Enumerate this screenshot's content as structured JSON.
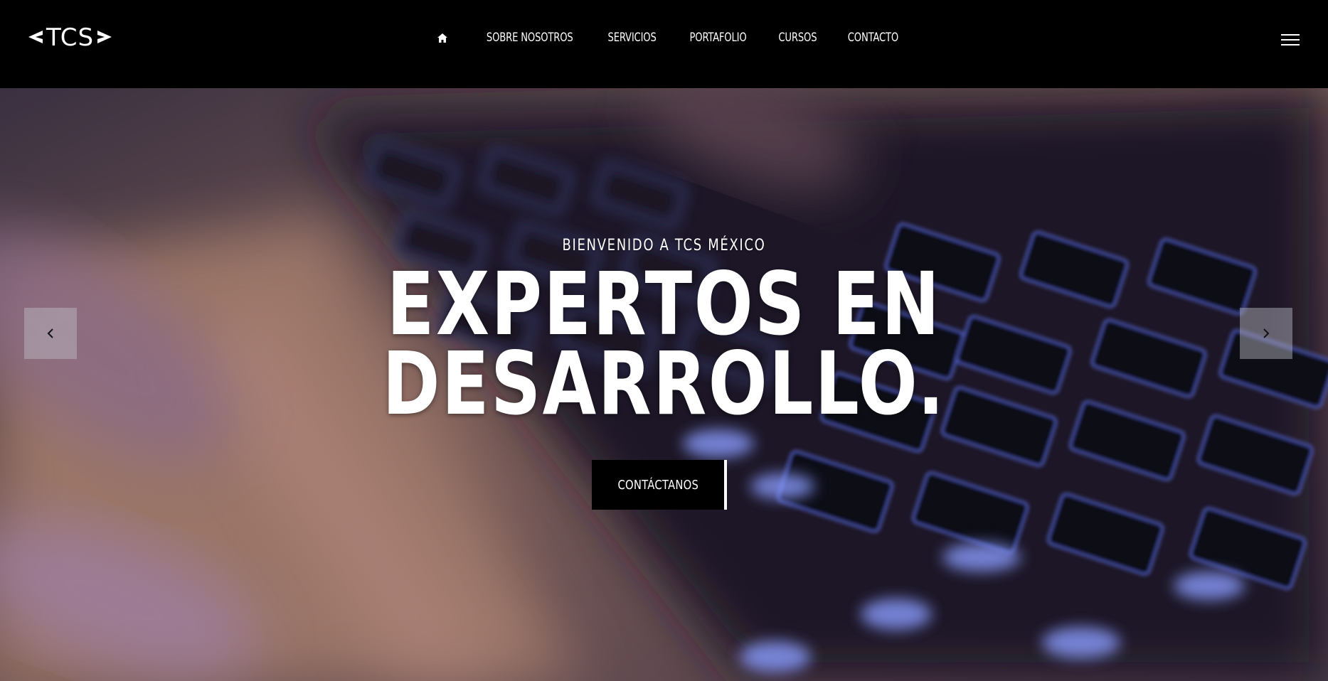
{
  "header": {
    "logo_text": "TCS",
    "nav": [
      {
        "label": "SOBRE NOSOTROS"
      },
      {
        "label": "SERVICIOS"
      },
      {
        "label": "PORTAFOLIO"
      },
      {
        "label": "CURSOS"
      },
      {
        "label": "CONTACTO"
      }
    ],
    "home_icon": "home-icon",
    "menu_icon": "hamburger-menu-icon"
  },
  "hero": {
    "kicker": "BIENVENIDO A TCS MÉXICO",
    "title_line1": "EXPERTOS EN",
    "title_line2": "DESARROLLO.",
    "cta_label": "CONTÁCTANOS",
    "prev_icon": "chevron-left-icon",
    "next_icon": "chevron-right-icon"
  },
  "colors": {
    "header_bg": "#000000",
    "text": "#ffffff",
    "cta_bg": "#000000"
  }
}
